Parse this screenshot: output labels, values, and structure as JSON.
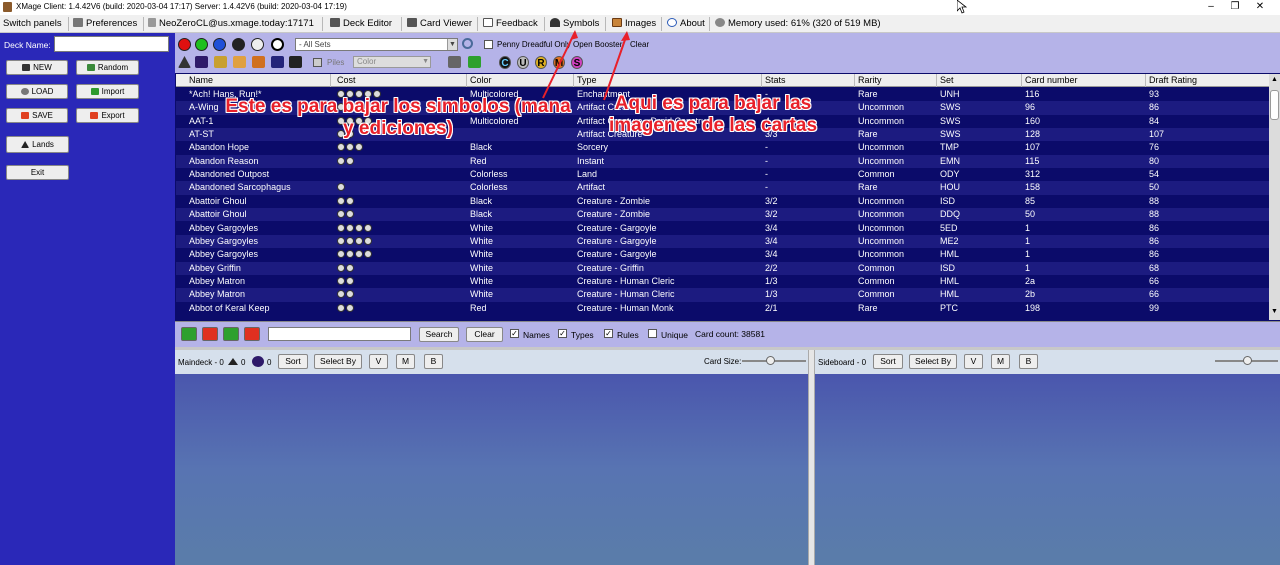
{
  "window": {
    "title": "XMage  Client: 1.4.42V6 (build: 2020-03-04 17:17)  Server: 1.4.42V6 (build: 2020-03-04 17:19)",
    "minimize": "–",
    "maximize": "❐",
    "close": "✕"
  },
  "menu": {
    "switch_panels": "Switch panels",
    "preferences": "Preferences",
    "connection": "NeoZeroCL@us.xmage.today:17171",
    "deck_editor": "Deck Editor",
    "card_viewer": "Card Viewer",
    "feedback": "Feedback",
    "symbols": "Symbols",
    "images": "Images",
    "about": "About",
    "memory": "Memory used: 61% (320 of 519 MB)"
  },
  "sidebar": {
    "deck_name_label": "Deck Name:",
    "deck_name_value": "",
    "new": "NEW",
    "random": "Random",
    "load": "LOAD",
    "import": "Import",
    "save": "SAVE",
    "export": "Export",
    "lands": "Lands",
    "exit": "Exit"
  },
  "filters": {
    "set_select": "- All Sets",
    "penny_dreadful": "Penny Dreadful Only",
    "open_booster": "Open Booster",
    "clear": "Clear",
    "piles": "Piles",
    "color_select": "Color",
    "rarity_letters": [
      "C",
      "U",
      "R",
      "M",
      "S"
    ]
  },
  "table": {
    "columns": [
      "Name",
      "Cost",
      "Color",
      "Type",
      "Stats",
      "Rarity",
      "Set",
      "Card number",
      "Draft Rating"
    ],
    "rows": [
      {
        "name": "*Ach! Hans, Run!*",
        "cost": 5,
        "color": "Multicolored",
        "type": "Enchantment",
        "stats": "-",
        "rarity": "Rare",
        "set": "UNH",
        "num": "116",
        "rating": "93"
      },
      {
        "name": "A-Wing",
        "cost": 2,
        "color": "",
        "type": "Artifact Creature",
        "stats": "",
        "rarity": "Uncommon",
        "set": "SWS",
        "num": "96",
        "rating": "86"
      },
      {
        "name": "AAT-1",
        "cost": 4,
        "color": "Multicolored",
        "type": "Artifact Creature - Droid Construct",
        "stats": "4",
        "rarity": "Uncommon",
        "set": "SWS",
        "num": "160",
        "rating": "84"
      },
      {
        "name": "AT-ST",
        "cost": 2,
        "color": "",
        "type": "Artifact Creature",
        "stats": "3/3",
        "rarity": "Rare",
        "set": "SWS",
        "num": "128",
        "rating": "107"
      },
      {
        "name": "Abandon Hope",
        "cost": 3,
        "color": "Black",
        "type": "Sorcery",
        "stats": "-",
        "rarity": "Uncommon",
        "set": "TMP",
        "num": "107",
        "rating": "76"
      },
      {
        "name": "Abandon Reason",
        "cost": 2,
        "color": "Red",
        "type": "Instant",
        "stats": "-",
        "rarity": "Uncommon",
        "set": "EMN",
        "num": "115",
        "rating": "80"
      },
      {
        "name": "Abandoned Outpost",
        "cost": 0,
        "color": "Colorless",
        "type": "Land",
        "stats": "-",
        "rarity": "Common",
        "set": "ODY",
        "num": "312",
        "rating": "54"
      },
      {
        "name": "Abandoned Sarcophagus",
        "cost": 1,
        "color": "Colorless",
        "type": "Artifact",
        "stats": "-",
        "rarity": "Rare",
        "set": "HOU",
        "num": "158",
        "rating": "50"
      },
      {
        "name": "Abattoir Ghoul",
        "cost": 2,
        "color": "Black",
        "type": "Creature  - Zombie",
        "stats": "3/2",
        "rarity": "Uncommon",
        "set": "ISD",
        "num": "85",
        "rating": "88"
      },
      {
        "name": "Abattoir Ghoul",
        "cost": 2,
        "color": "Black",
        "type": "Creature  - Zombie",
        "stats": "3/2",
        "rarity": "Uncommon",
        "set": "DDQ",
        "num": "50",
        "rating": "88"
      },
      {
        "name": "Abbey Gargoyles",
        "cost": 4,
        "color": "White",
        "type": "Creature  - Gargoyle",
        "stats": "3/4",
        "rarity": "Uncommon",
        "set": "5ED",
        "num": "1",
        "rating": "86"
      },
      {
        "name": "Abbey Gargoyles",
        "cost": 4,
        "color": "White",
        "type": "Creature  - Gargoyle",
        "stats": "3/4",
        "rarity": "Uncommon",
        "set": "ME2",
        "num": "1",
        "rating": "86"
      },
      {
        "name": "Abbey Gargoyles",
        "cost": 4,
        "color": "White",
        "type": "Creature  - Gargoyle",
        "stats": "3/4",
        "rarity": "Uncommon",
        "set": "HML",
        "num": "1",
        "rating": "86"
      },
      {
        "name": "Abbey Griffin",
        "cost": 2,
        "color": "White",
        "type": "Creature  - Griffin",
        "stats": "2/2",
        "rarity": "Common",
        "set": "ISD",
        "num": "1",
        "rating": "68"
      },
      {
        "name": "Abbey Matron",
        "cost": 2,
        "color": "White",
        "type": "Creature  - Human Cleric",
        "stats": "1/3",
        "rarity": "Common",
        "set": "HML",
        "num": "2a",
        "rating": "66"
      },
      {
        "name": "Abbey Matron",
        "cost": 2,
        "color": "White",
        "type": "Creature  - Human Cleric",
        "stats": "1/3",
        "rarity": "Common",
        "set": "HML",
        "num": "2b",
        "rating": "66"
      },
      {
        "name": "Abbot of Keral Keep",
        "cost": 2,
        "color": "Red",
        "type": "Creature  - Human Monk",
        "stats": "2/1",
        "rarity": "Rare",
        "set": "PTC",
        "num": "198",
        "rating": "99"
      }
    ]
  },
  "deckbar": {
    "search": "Search",
    "clear": "Clear",
    "names": "Names",
    "types": "Types",
    "rules": "Rules",
    "unique": "Unique",
    "card_count": "Card count:  38581"
  },
  "maindeck": {
    "label": "Maindeck - 0",
    "lands_count": "0",
    "creatures_count": "0",
    "sort": "Sort",
    "select_by": "Select By",
    "v": "V",
    "m": "M",
    "b": "B",
    "card_size": "Card Size:"
  },
  "sideboard": {
    "label": "Sideboard - 0",
    "sort": "Sort",
    "select_by": "Select By",
    "v": "V",
    "m": "M",
    "b": "B"
  },
  "annotations": {
    "symbols_note": "Este es para bajar los simbolos (mana y ediciones)",
    "images_note": "Aqui es para bajar las imagenes de las cartas",
    "color": "#e8202a"
  }
}
